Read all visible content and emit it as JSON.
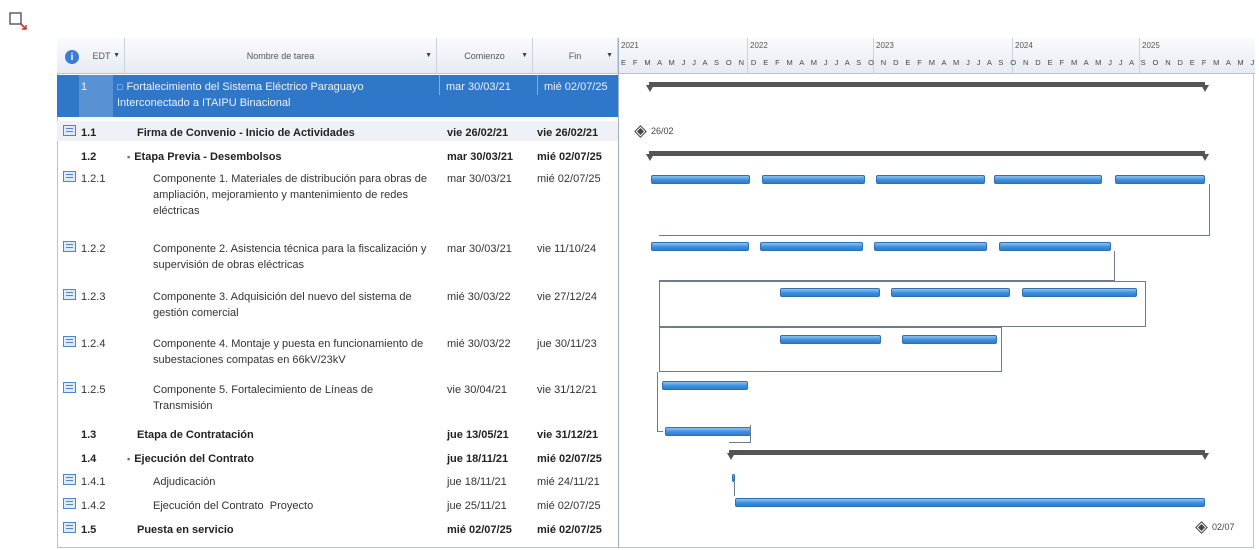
{
  "columns": {
    "edt": "EDT",
    "name": "Nombre de tarea",
    "start": "Comienzo",
    "end": "Fin"
  },
  "timeline": {
    "years": [
      "2021",
      "2022",
      "2023",
      "2024",
      "2025"
    ],
    "months": "E F M A M J J A S O N D E F M A M J J A S O N D E F M A M J J A S O N D E F M A M J J A S O N D E F M A M J J A S O N D"
  },
  "tasks": [
    {
      "edt": "1",
      "name": "Fortalecimiento del Sistema Eléctrico Paraguayo Interconectado a ITAIPU Binacional",
      "start": "mar 30/03/21",
      "end": "mié 02/07/25"
    },
    {
      "edt": "1.1",
      "name": "Firma de Convenio - Inicio de Actividades",
      "start": "vie 26/02/21",
      "end": "vie 26/02/21"
    },
    {
      "edt": "1.2",
      "name": "Etapa Previa - Desembolsos",
      "start": "mar 30/03/21",
      "end": "mié 02/07/25"
    },
    {
      "edt": "1.2.1",
      "name": "Componente 1. Materiales de distribución para obras de ampliación, mejoramiento y mantenimiento de redes eléctricas",
      "start": "mar 30/03/21",
      "end": "mié 02/07/25"
    },
    {
      "edt": "1.2.2",
      "name": "Componente 2. Asistencia técnica para la fiscalización y supervisión de obras eléctricas",
      "start": "mar 30/03/21",
      "end": "vie 11/10/24"
    },
    {
      "edt": "1.2.3",
      "name": "Componente 3. Adquisición del nuevo del sistema de gestión comercial",
      "start": "mié 30/03/22",
      "end": "vie 27/12/24"
    },
    {
      "edt": "1.2.4",
      "name": "Componente 4. Montaje y puesta en funcionamiento de subestaciones compatas en 66kV/23kV",
      "start": "mié 30/03/22",
      "end": "jue 30/11/23"
    },
    {
      "edt": "1.2.5",
      "name": "Componente 5. Fortalecimiento de Líneas de Transmisión",
      "start": "vie 30/04/21",
      "end": "vie 31/12/21"
    },
    {
      "edt": "1.3",
      "name": "Etapa de Contratación",
      "start": "jue 13/05/21",
      "end": "vie 31/12/21"
    },
    {
      "edt": "1.4",
      "name": "Ejecución del Contrato",
      "start": "jue 18/11/21",
      "end": "mié 02/07/25"
    },
    {
      "edt": "1.4.1",
      "name": "Adjudicación",
      "start": "jue 18/11/21",
      "end": "mié 24/11/21"
    },
    {
      "edt": "1.4.2",
      "name": "Ejecución del Contrato  Proyecto",
      "start": "jue 25/11/21",
      "end": "mié 02/07/25"
    },
    {
      "edt": "1.5",
      "name": "Puesta en servicio",
      "start": "mié 02/07/25",
      "end": "mié 02/07/25"
    }
  ],
  "milestones": {
    "m1_label": "26/02",
    "m2_label": "02/07"
  },
  "colors": {
    "selection": "#2f77c8",
    "bar": "#3c8fe0",
    "summary": "#555555"
  }
}
